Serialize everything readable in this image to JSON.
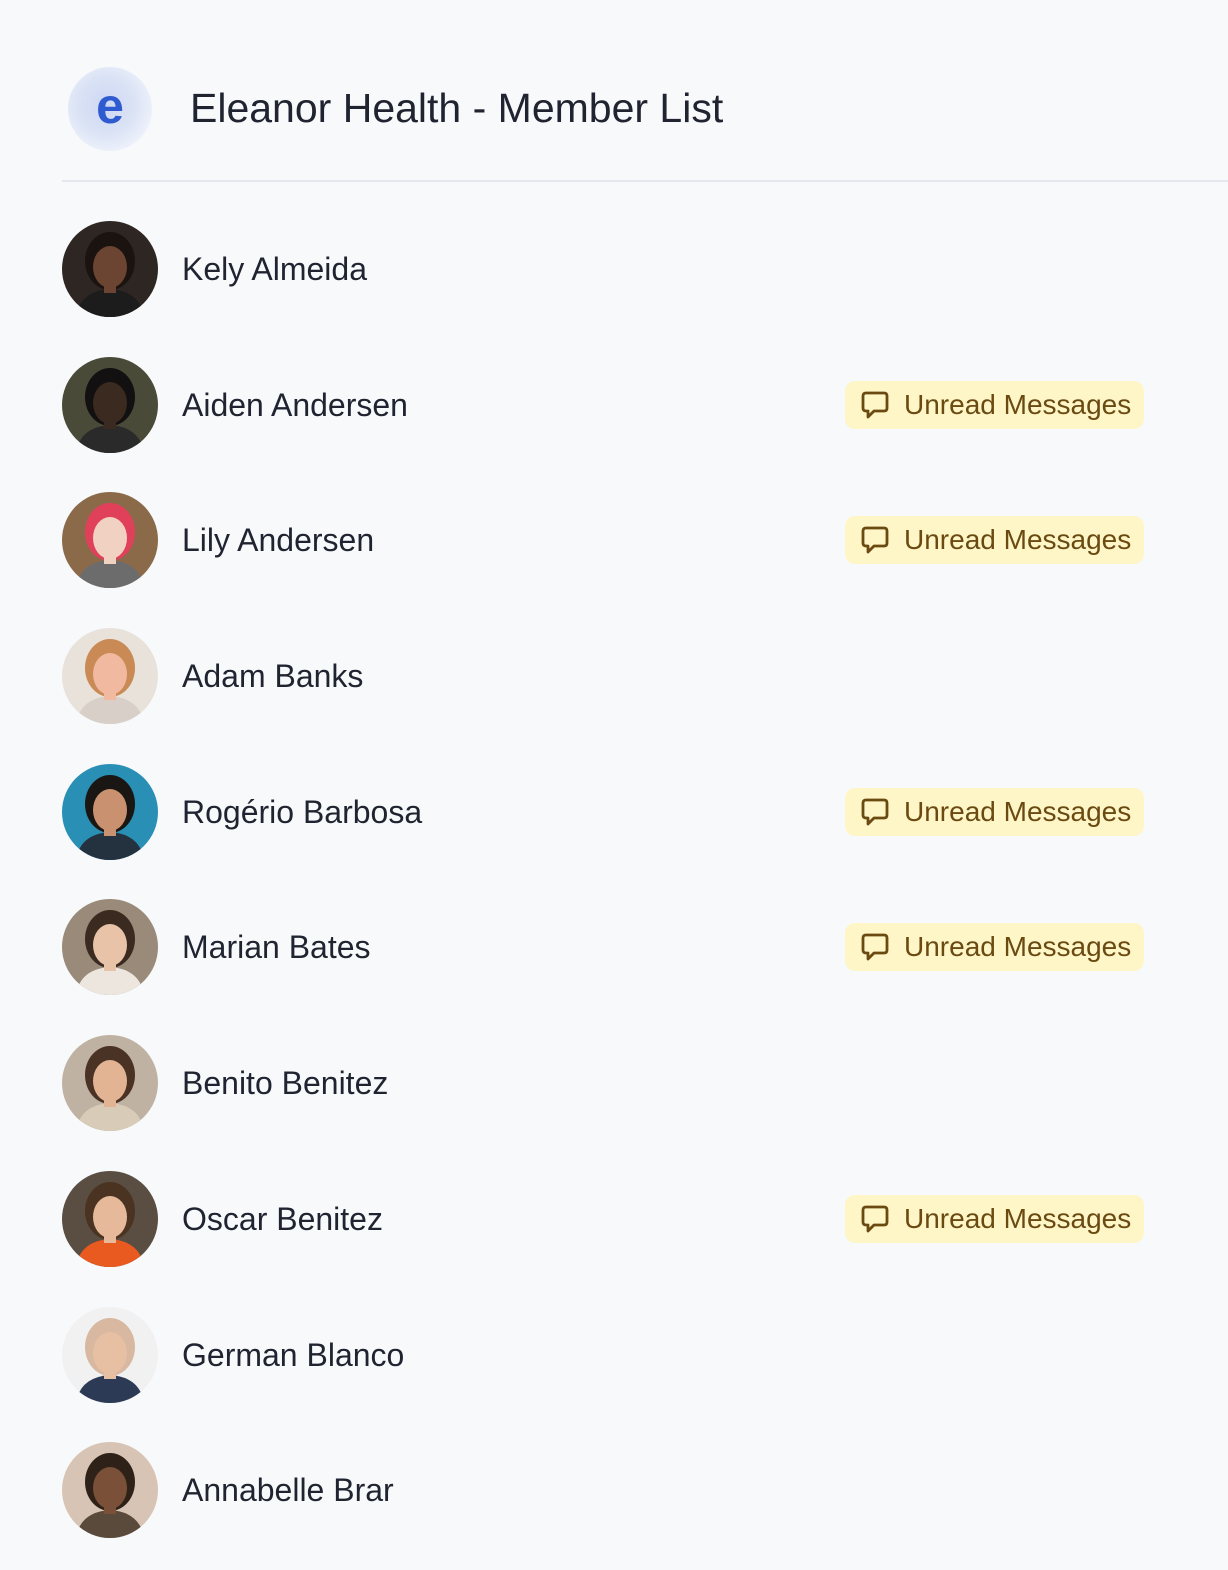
{
  "header": {
    "logo_letter": "e",
    "title": "Eleanor Health - Member List"
  },
  "colors": {
    "background": "#f7f9fb",
    "badge_background": "#fef6c7",
    "badge_text": "#6b4a12",
    "logo_letter": "#2f5bd0"
  },
  "members": [
    {
      "name": "Kely Almeida",
      "unread": false,
      "badge_label": "",
      "avatar": {
        "bg": "#2e2622",
        "skin": "#6b4432",
        "hair": "#1a1310",
        "shirt": "#1c1c1c"
      }
    },
    {
      "name": "Aiden Andersen",
      "unread": true,
      "badge_label": "Unread Messages",
      "avatar": {
        "bg": "#4a4a38",
        "skin": "#3b2a20",
        "hair": "#121010",
        "shirt": "#2a2a2a"
      }
    },
    {
      "name": "Lily Andersen",
      "unread": true,
      "badge_label": "Unread Messages",
      "avatar": {
        "bg": "#8b6a4a",
        "skin": "#f1d2c2",
        "hair": "#e0405a",
        "shirt": "#6c6c6c"
      }
    },
    {
      "name": "Adam Banks",
      "unread": false,
      "badge_label": "",
      "avatar": {
        "bg": "#e9e2da",
        "skin": "#f0b9a0",
        "hair": "#c98a55",
        "shirt": "#d8d0c8"
      }
    },
    {
      "name": "Rogério Barbosa",
      "unread": true,
      "badge_label": "Unread Messages",
      "avatar": {
        "bg": "#2a8fb5",
        "skin": "#c99170",
        "hair": "#1a1614",
        "shirt": "#24323f"
      }
    },
    {
      "name": "Marian Bates",
      "unread": true,
      "badge_label": "Unread Messages",
      "avatar": {
        "bg": "#9a8a7a",
        "skin": "#e8c3a8",
        "hair": "#3a2a20",
        "shirt": "#ece6de"
      }
    },
    {
      "name": "Benito Benitez",
      "unread": false,
      "badge_label": "",
      "avatar": {
        "bg": "#bfb2a2",
        "skin": "#e2b494",
        "hair": "#4a3324",
        "shirt": "#d8cbb8"
      }
    },
    {
      "name": "Oscar Benitez",
      "unread": true,
      "badge_label": "Unread Messages",
      "avatar": {
        "bg": "#5a4d42",
        "skin": "#e6b99a",
        "hair": "#4b3322",
        "shirt": "#e85a20"
      }
    },
    {
      "name": "German Blanco",
      "unread": false,
      "badge_label": "",
      "avatar": {
        "bg": "#f1f1f1",
        "skin": "#e7c0a4",
        "hair": "#d8b8a0",
        "shirt": "#2c3a55"
      }
    },
    {
      "name": "Annabelle Brar",
      "unread": false,
      "badge_label": "",
      "avatar": {
        "bg": "#d8c4b4",
        "skin": "#7a5038",
        "hair": "#2e2218",
        "shirt": "#5a4a3c"
      }
    }
  ]
}
